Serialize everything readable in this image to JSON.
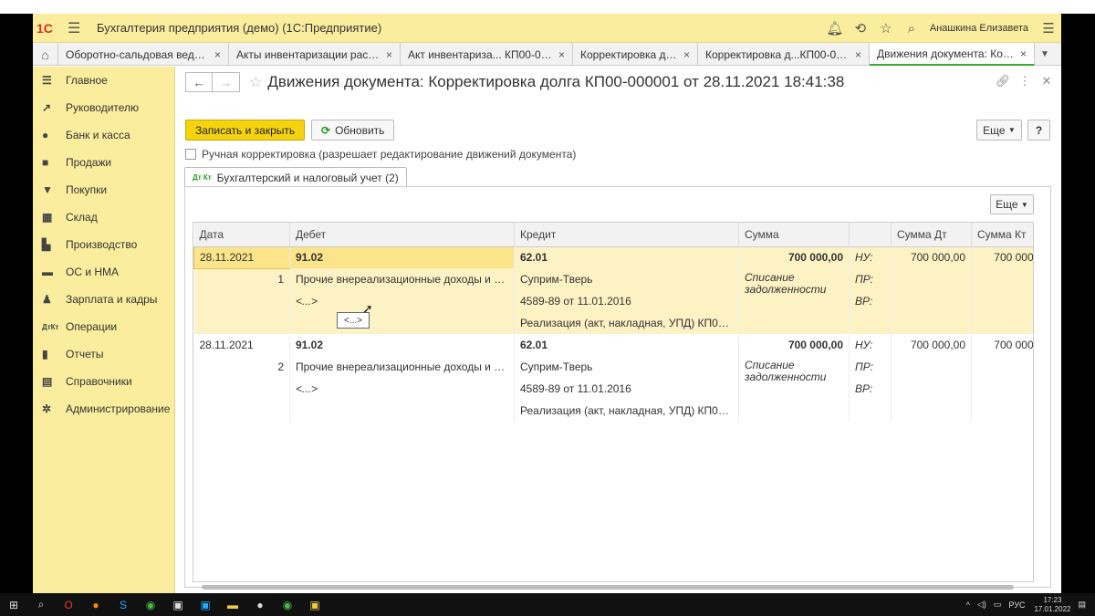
{
  "app": {
    "title": "Бухгалтерия предприятия (демо)  (1С:Предприятие)",
    "logo": "1С",
    "user": "Анашкина Елизавета"
  },
  "tabs": [
    {
      "label": "Оборотно-сальдовая ведомо...",
      "close": "×"
    },
    {
      "label": "Акты инвентаризации расчет...",
      "close": "×"
    },
    {
      "label": "Акт инвентариза... КП00-000001",
      "close": "×"
    },
    {
      "label": "Корректировка долга",
      "close": "×"
    },
    {
      "label": "Корректировка д...КП00-000001",
      "close": "×"
    },
    {
      "label": "Движения документа: Корре...",
      "close": "×"
    }
  ],
  "sidebar": [
    {
      "label": "Главное",
      "icon": "menu-icon"
    },
    {
      "label": "Руководителю",
      "icon": "trend-icon"
    },
    {
      "label": "Банк и касса",
      "icon": "coin-icon"
    },
    {
      "label": "Продажи",
      "icon": "bag-icon"
    },
    {
      "label": "Покупки",
      "icon": "cart-icon"
    },
    {
      "label": "Склад",
      "icon": "grid-icon"
    },
    {
      "label": "Производство",
      "icon": "factory-icon"
    },
    {
      "label": "ОС и НМА",
      "icon": "truck-icon"
    },
    {
      "label": "Зарплата и кадры",
      "icon": "person-icon"
    },
    {
      "label": "Операции",
      "icon": "dtkt-icon"
    },
    {
      "label": "Отчеты",
      "icon": "chart-icon"
    },
    {
      "label": "Справочники",
      "icon": "book-icon"
    },
    {
      "label": "Администрирование",
      "icon": "gear-icon"
    }
  ],
  "doc": {
    "title": "Движения документа: Корректировка долга КП00-000001 от 28.11.2021 18:41:38",
    "save_label": "Записать и закрыть",
    "refresh_label": "Обновить",
    "more_label": "Еще",
    "help_label": "?",
    "checkbox_label": "Ручная корректировка (разрешает редактирование движений документа)",
    "tab_label": "Бухгалтерский и налоговый учет (2)",
    "tab_icon_text": "Дт Кт"
  },
  "grid": {
    "columns": [
      "Дата",
      "Дебет",
      "Кредит",
      "Сумма",
      "",
      "Сумма Дт",
      "Сумма Кт"
    ],
    "rows": [
      {
        "date": "28.11.2021",
        "num": "1",
        "debit": "91.02",
        "debit_sub": "Прочие внереализационные доходы и рас...",
        "debit_sub2": "<...>",
        "credit": "62.01",
        "credit_sub1": "Суприм-Тверь",
        "credit_sub2": "4589-89 от 11.01.2016",
        "credit_sub3": "Реализация (акт, накладная, УПД) КП00-00...",
        "sum": "700 000,00",
        "desc": "Списание задолженности",
        "nu": "НУ:",
        "pr": "ПР:",
        "vr": "ВР:",
        "sum_dt": "700 000,00",
        "sum_kt": "700 000,"
      },
      {
        "date": "28.11.2021",
        "num": "2",
        "debit": "91.02",
        "debit_sub": "Прочие внереализационные доходы и рас...",
        "debit_sub2": "<...>",
        "credit": "62.01",
        "credit_sub1": "Суприм-Тверь",
        "credit_sub2": "4589-89 от 11.01.2016",
        "credit_sub3": "Реализация (акт, накладная, УПД) КП00-00...",
        "sum": "700 000,00",
        "desc": "Списание задолженности",
        "nu": "НУ:",
        "pr": "ПР:",
        "vr": "ВР:",
        "sum_dt": "700 000,00",
        "sum_kt": "700 000,"
      }
    ]
  },
  "tooltip": "<...>",
  "taskbar": {
    "lang": "РУС",
    "time": "17:23",
    "date": "17.01.2022"
  }
}
